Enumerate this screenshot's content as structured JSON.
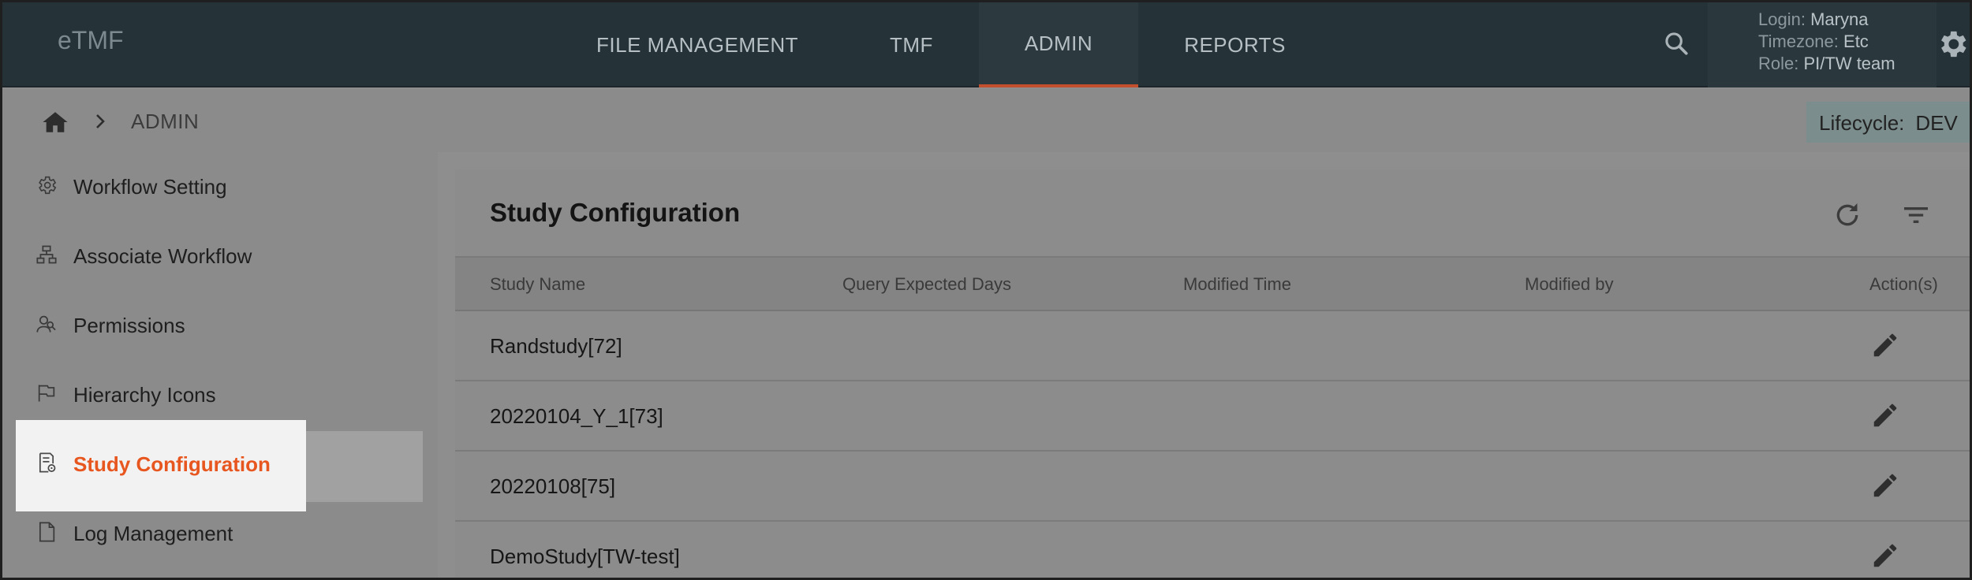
{
  "app": {
    "logo": "eTMF"
  },
  "nav": {
    "items": [
      {
        "label": "FILE MANAGEMENT"
      },
      {
        "label": "TMF"
      },
      {
        "label": "ADMIN"
      },
      {
        "label": "REPORTS"
      }
    ],
    "active": "ADMIN"
  },
  "user": {
    "login_label": "Login:",
    "login_value": "Maryna",
    "timezone_label": "Timezone:",
    "timezone_value": "Etc",
    "role_label": "Role:",
    "role_value": "PI/TW team"
  },
  "breadcrumb": {
    "current": "ADMIN"
  },
  "lifecycle": {
    "label": "Lifecycle:",
    "value": "DEV"
  },
  "sidebar": {
    "items": [
      {
        "label": "Workflow Setting",
        "icon": "gear-icon"
      },
      {
        "label": "Associate Workflow",
        "icon": "hierarchy-icon"
      },
      {
        "label": "Permissions",
        "icon": "users-icon"
      },
      {
        "label": "Hierarchy Icons",
        "icon": "flag-icon"
      },
      {
        "label": "Study Configuration",
        "icon": "document-settings-icon"
      },
      {
        "label": "Log Management",
        "icon": "file-icon"
      }
    ],
    "active": "Study Configuration"
  },
  "main": {
    "title": "Study Configuration",
    "columns": [
      "Study Name",
      "Query Expected Days",
      "Modified Time",
      "Modified by",
      "Action(s)"
    ],
    "rows": [
      {
        "name": "Randstudy[72]"
      },
      {
        "name": "20220104_Y_1[73]"
      },
      {
        "name": "20220108[75]"
      },
      {
        "name": "DemoStudy[TW-test]"
      }
    ]
  },
  "colors": {
    "topbar": "#253339",
    "accent": "#e8561f",
    "overlay": "#8b8b8b"
  }
}
